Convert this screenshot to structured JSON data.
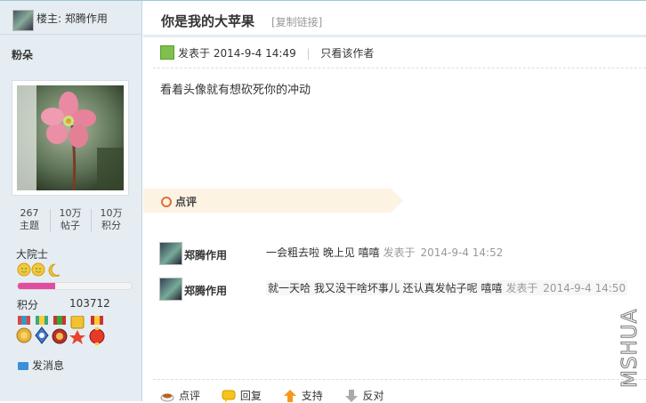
{
  "left": {
    "louzhu": "楼主: 郑腾作用",
    "username": "粉朵",
    "stats": [
      {
        "value": "267",
        "label": "主题"
      },
      {
        "value": "10万",
        "label": "帖子"
      },
      {
        "value": "10万",
        "label": "积分"
      }
    ],
    "rank": "大院士",
    "progress": 0.33,
    "score_label": "积分",
    "score_value": "103712",
    "send_message": "发消息",
    "colors": {
      "progress": "#e04ea2",
      "sidebar_bg": "#e5edf2"
    }
  },
  "thread": {
    "title": "你是我的大苹果",
    "copy_link": "[复制链接]"
  },
  "post": {
    "posted_prefix": "发表于",
    "posted_time": "2014-9-4 14:49",
    "only_author": "只看该作者",
    "content": "看着头像就有想砍死你的冲动"
  },
  "dianping": {
    "label": "点评",
    "comments": [
      {
        "author": "郑腾作用",
        "text": "一会粗去啦 晚上见 嘻嘻",
        "time_prefix": "发表于",
        "time": "2014-9-4 14:52"
      },
      {
        "author": "郑腾作用",
        "text": "就一天哈 我又没干啥坏事儿 还认真发帖子呢 嘻嘻",
        "time_prefix": "发表于",
        "time": "2014-9-4 14:50"
      }
    ]
  },
  "actions": {
    "comment": "点评",
    "reply": "回复",
    "support": "支持",
    "oppose": "反对"
  },
  "watermark": "MSHUA"
}
